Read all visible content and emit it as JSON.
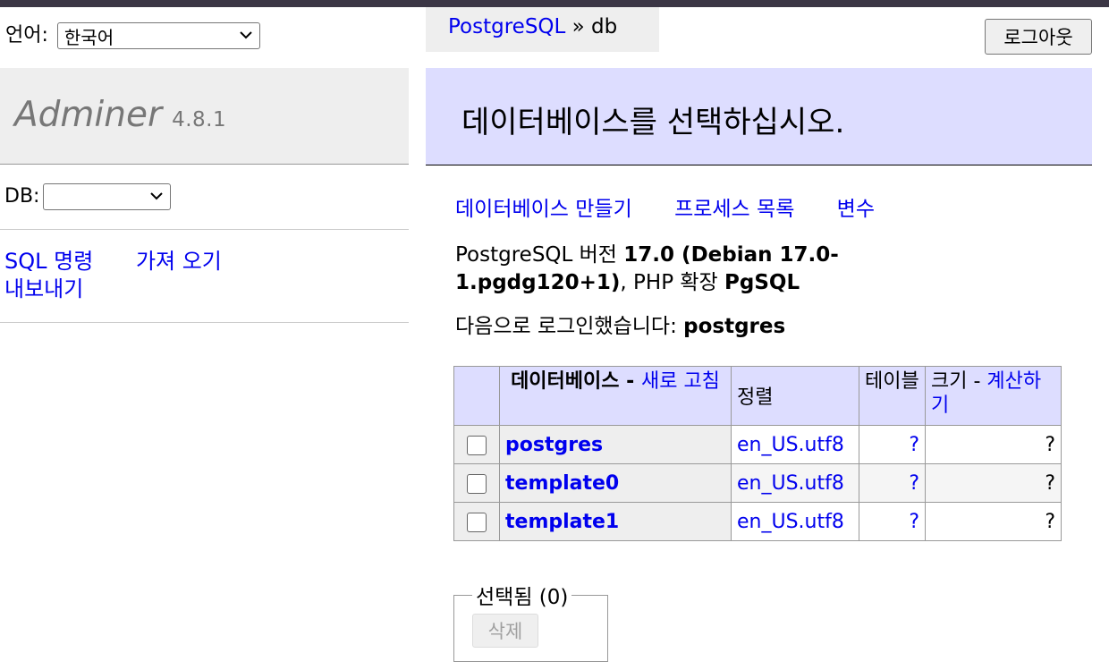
{
  "language": {
    "label": "언어:",
    "selected": "한국어"
  },
  "brand": {
    "name": "Adminer",
    "version": "4.8.1"
  },
  "db_select": {
    "label": "DB:",
    "selected": ""
  },
  "menu_links": {
    "sql": "SQL 명령",
    "import": "가져 오기",
    "export": "내보내기"
  },
  "breadcrumb": {
    "driver": "PostgreSQL",
    "sep": " » ",
    "current": "db"
  },
  "logout": "로그아웃",
  "heading": "데이터베이스를 선택하십시오.",
  "actions": {
    "create": "데이터베이스 만들기",
    "processes": "프로세스 목록",
    "variables": "변수"
  },
  "version_info": {
    "prefix": "PostgreSQL 버전 ",
    "version": "17.0 (Debian 17.0-1.pgdg120+1)",
    "mid": ", PHP 확장 ",
    "ext": "PgSQL"
  },
  "login_info": {
    "prefix": "다음으로 로그인했습니다: ",
    "user": "postgres"
  },
  "table": {
    "headers": {
      "database": "데이터베이스",
      "dash": " - ",
      "refresh": "새로 고침",
      "collation": "정렬",
      "tables": "테이블",
      "size": "크기",
      "compute": "계산하기"
    },
    "rows": [
      {
        "name": "postgres",
        "collation": "en_US.utf8",
        "tables": "?",
        "size": "?"
      },
      {
        "name": "template0",
        "collation": "en_US.utf8",
        "tables": "?",
        "size": "?"
      },
      {
        "name": "template1",
        "collation": "en_US.utf8",
        "tables": "?",
        "size": "?"
      }
    ]
  },
  "selected_box": {
    "legend": "선택됨 (0)",
    "delete": "삭제"
  }
}
